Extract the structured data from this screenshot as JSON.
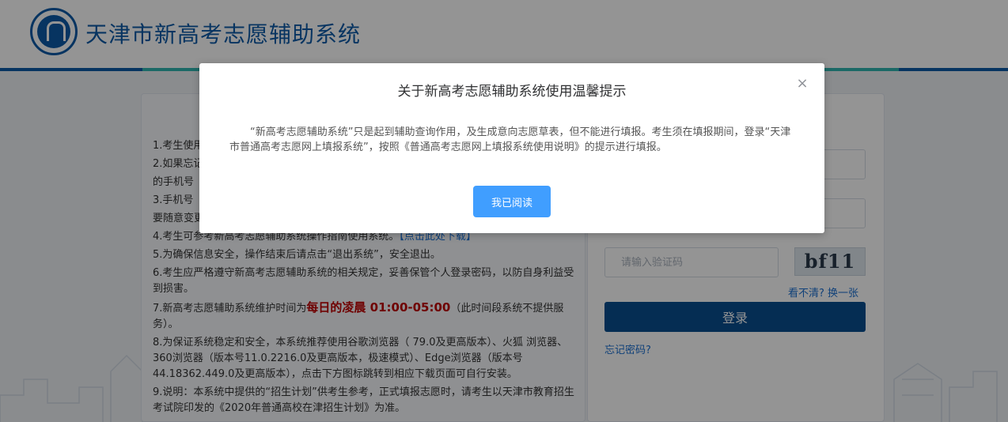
{
  "header": {
    "site_title": "天津市新高考志愿辅助系统"
  },
  "notice": {
    "items": [
      "1.考生使用",
      "2.如果忘记",
      "的手机号",
      "3.手机号",
      "要随意变更",
      "4.考生可参考新高考志愿辅助系统操作指南使用系统。",
      "5.为确保信息安全，操作结束后请点击“退出系统”，安全退出。",
      "6.考生应严格遵守新高考志愿辅助系统的相关规定，妥善保管个人登录密码，以防自身利益受到损害。",
      "8.为保证系统稳定和安全，本系统推荐使用谷歌浏览器（ 79.0及更高版本）、火狐 浏览器、360浏览器（版本号11.0.2216.0及更高版本，极速模式）、Edge浏览器（版本号44.18362.449.0及更高版本），点击下方图标跳转到相应下载页面可自行安装。",
      "9.说明：本系统中提供的“招生计划”供考生参考，正式填报志愿时，请考生以天津市教育招生考试院印发的《2020年普通高校在津招生计划》为准。"
    ],
    "download_link": "【点击此处下载】",
    "item7_prefix": "7.新高考志愿辅助系统维护时间为",
    "item7_highlight": "每日的凌晨 01:00-05:00",
    "item7_suffix": "（此时间段系统不提供服务）。"
  },
  "login": {
    "captcha_placeholder": "请输入验证码",
    "captcha_text": "bf11",
    "refresh_captcha": "看不清? 换一张",
    "login_button": "登录",
    "forgot_password": "忘记密码?"
  },
  "modal": {
    "title": "关于新高考志愿辅助系统使用温馨提示",
    "close_symbol": "×",
    "body": "“新高考志愿辅助系统”只是起到辅助查询作用，及生成意向志愿草表，但不能进行填报。考生须在填报期间，登录“天津市普通高考志愿网上填报系统”，按照《普通高考志愿网上填报系统使用说明》的提示进行填报。",
    "ok_button": "我已阅读"
  },
  "colors": {
    "brand_blue": "#0d5aa7",
    "accent_teal": "#2fb5b0",
    "primary_button": "#409eff",
    "login_button": "#0a4e8f",
    "warning_red": "#c00000"
  }
}
